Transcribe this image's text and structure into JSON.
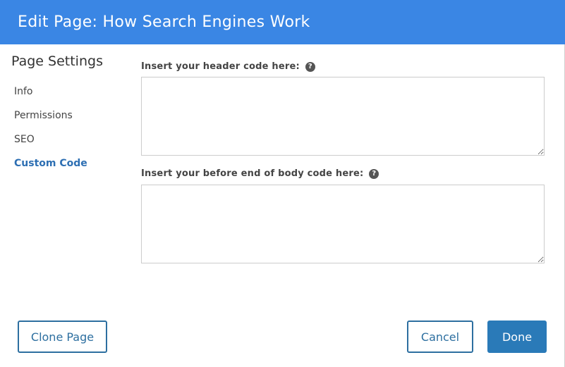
{
  "header": {
    "title": "Edit Page: How Search Engines Work"
  },
  "sidebar": {
    "title": "Page Settings",
    "items": [
      {
        "label": "Info",
        "active": false
      },
      {
        "label": "Permissions",
        "active": false
      },
      {
        "label": "SEO",
        "active": false
      },
      {
        "label": "Custom Code",
        "active": true
      }
    ]
  },
  "fields": {
    "header_code": {
      "label": "Insert your header code here:",
      "value": "",
      "help_icon": "question-circle-icon"
    },
    "body_code": {
      "label": "Insert your before end of body code here:",
      "value": "",
      "help_icon": "question-circle-icon"
    }
  },
  "footer": {
    "clone_label": "Clone Page",
    "cancel_label": "Cancel",
    "done_label": "Done"
  },
  "colors": {
    "header_bg": "#3a86e4",
    "active_nav": "#2d6fb3",
    "primary_button": "#2a7ab8",
    "outline_button": "#2d6fa0"
  }
}
